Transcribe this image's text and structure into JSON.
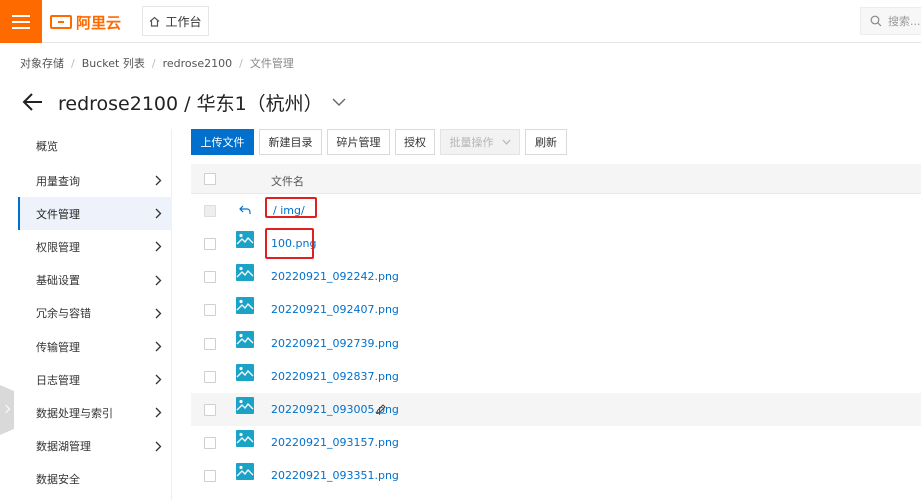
{
  "header": {
    "brand": "阿里云",
    "workbench_label": "工作台",
    "search_placeholder": "搜索..."
  },
  "breadcrumb": [
    "对象存储",
    "Bucket 列表",
    "redrose2100",
    "文件管理"
  ],
  "page_title": "redrose2100 / 华东1（杭州）",
  "sidebar": {
    "items": [
      {
        "label": "概览",
        "chevron": false,
        "active": false
      },
      {
        "label": "用量查询",
        "chevron": true,
        "active": false
      },
      {
        "label": "文件管理",
        "chevron": true,
        "active": true
      },
      {
        "label": "权限管理",
        "chevron": true,
        "active": false
      },
      {
        "label": "基础设置",
        "chevron": true,
        "active": false
      },
      {
        "label": "冗余与容错",
        "chevron": true,
        "active": false
      },
      {
        "label": "传输管理",
        "chevron": true,
        "active": false
      },
      {
        "label": "日志管理",
        "chevron": true,
        "active": false
      },
      {
        "label": "数据处理与索引",
        "chevron": true,
        "active": false
      },
      {
        "label": "数据湖管理",
        "chevron": true,
        "active": false
      },
      {
        "label": "数据安全",
        "chevron": false,
        "active": false
      }
    ]
  },
  "toolbar": {
    "upload": "上传文件",
    "new_dir": "新建目录",
    "fragments": "碎片管理",
    "authorize": "授权",
    "batch": "批量操作",
    "refresh": "刷新"
  },
  "table": {
    "column_filename": "文件名",
    "parent_path": "/ img/",
    "files": [
      "100.png",
      "20220921_092242.png",
      "20220921_092407.png",
      "20220921_092739.png",
      "20220921_092837.png",
      "20220921_093005.png",
      "20220921_093157.png",
      "20220921_093351.png"
    ]
  },
  "colors": {
    "brand": "#ff6a00",
    "primary": "#0070cc",
    "highlight": "#e02020",
    "file_icon": "#1aa3c7"
  },
  "icons": {
    "menu": "hamburger-icon",
    "workbench": "home-icon",
    "search": "search-icon",
    "back": "arrow-left-icon",
    "parent": "return-icon",
    "file": "image-file-icon",
    "edit": "pencil-icon"
  }
}
